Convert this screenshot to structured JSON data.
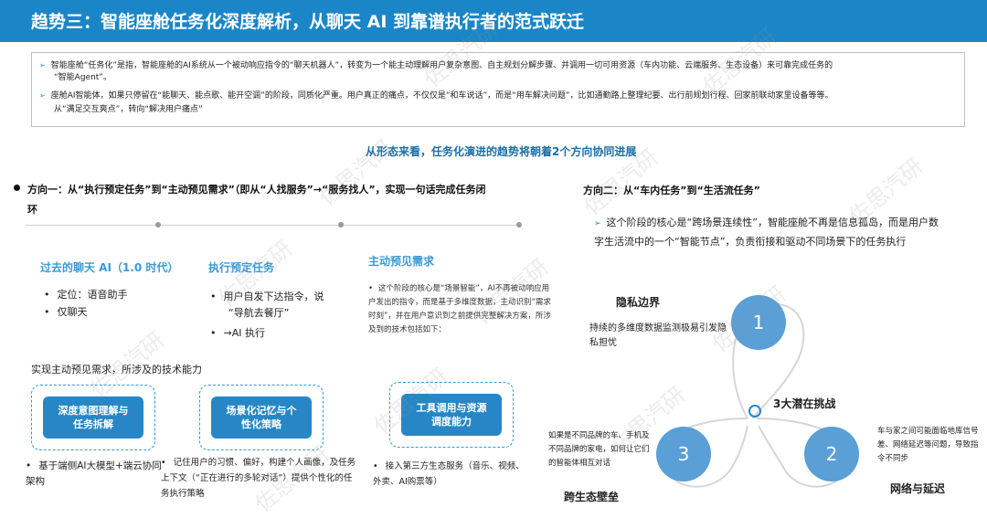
{
  "header": {
    "title": "趋势三：智能座舱任务化深度解析，从聊天 AI 到靠谱执行者的范式跃迁"
  },
  "intro": {
    "lines": [
      "智能座舱“任务化”是指，智能座舱的AI系统从一个被动响应指令的“聊天机器人”，转变为一个能主动理解用户复杂意图、自主规划分解步骤、并调用一切可用资源（车内功能、云端服务、生态设备）来可靠完成任务的",
      "“智能Agent”。",
      "座舱AI智能体，如果只停留在“能聊天、能点歌、能开空调”的阶段，同质化严重。用户真正的痛点，不仅仅是“和车说话”，而是“用车解决问题”，比如通勤路上整理纪要、出行前规划行程、回家前联动家里设备等等。",
      "从“满足交互爽点”，转向“解决用户痛点”"
    ]
  },
  "trend_headline": "从形态来看，任务化演进的趋势将朝着2个方向协同进展",
  "direction_one": {
    "title": "方向一：从“执行预定任务”到“主动预见需求”（即从“人找服务”→“服务找人”，实现一句话完成任务闭环",
    "columns": [
      {
        "heading": "过去的聊天 AI（1.0 时代）",
        "items": [
          "定位：语音助手",
          "仅聊天"
        ]
      },
      {
        "heading": "执行预定任务",
        "items": [
          "用户自发下达指令，说",
          "“导航去餐厅”",
          "→AI 执行"
        ]
      },
      {
        "heading": "主动预见需求"
      }
    ],
    "active_desc": "这个阶段的核心是“场景智能”，AI不再被动响应用户发出的指令，而是基于多维度数据，主动识别“需求时刻”，并在用户意识到之前提供完整解决方案，所涉及到的技术包括如下：",
    "tech_caption": "实现主动预见需求，所涉及的技术能力",
    "capabilities": [
      {
        "label_line1": "深度意图理解与",
        "label_line2": "任务拆解",
        "note": "基于端侧AI大模型+端云协同架构"
      },
      {
        "label_line1": "场景化记忆与个",
        "label_line2": "性化策略",
        "note": "记住用户的习惯、偏好，构建个人画像，及任务上下文（“正在进行的多轮对话”）提供个性化的任务执行策略"
      },
      {
        "label_line1": "工具调用与资源",
        "label_line2": "调度能力",
        "note": "接入第三方生态服务（音乐、视频、外卖、AI购票等）"
      }
    ]
  },
  "direction_two": {
    "title": "方向二：从“车内任务”到“生活流任务”",
    "desc": "这个阶段的核心是“跨场景连续性”，智能座舱不再是信息孤岛，而是用户数字生活流中的一个“智能节点”，负责衔接和驱动不同场景下的任务执行",
    "center_title": "3大潜在挑战",
    "challenges": [
      {
        "num": "1",
        "title": "隐私边界",
        "text": "持续的多维度数据监测极易引发隐私担忧"
      },
      {
        "num": "2",
        "title": "网络与延迟",
        "text": "车与家之间可能面临地库信号差、网络延迟等问题，导致指令不同步"
      },
      {
        "num": "3",
        "title": "跨生态壁垒",
        "text": "如果是不同品牌的车、手机及不同品牌的家电，如何让它们的智能体相互对话"
      }
    ]
  },
  "watermark": "佐思汽研",
  "colors": {
    "header_bg": "#1a86c7",
    "accent": "#2787c6",
    "circle": "#5a9fd6",
    "heading_blue": "#3a9ad6"
  }
}
